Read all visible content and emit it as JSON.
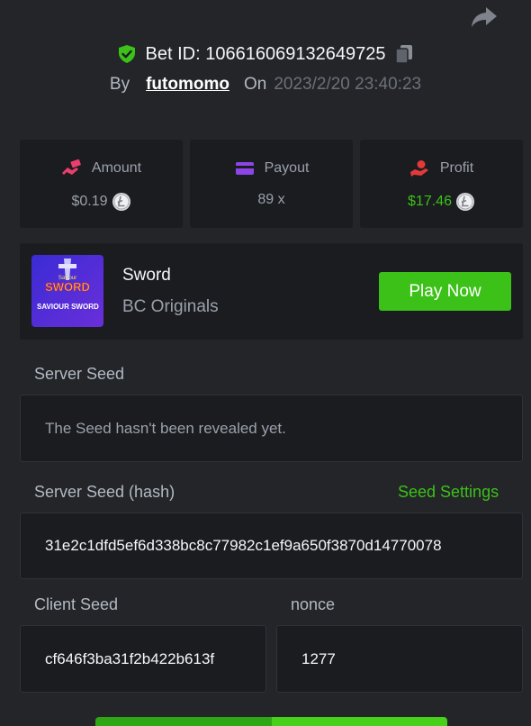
{
  "header": {
    "bet_label": "Bet ID: 106616069132649725",
    "by": "By",
    "user": "futomomo",
    "on": "On",
    "datetime": "2023/2/20 23:40:23"
  },
  "stats": {
    "amount": {
      "label": "Amount",
      "value": "$0.19",
      "icon": "money-hand-icon"
    },
    "payout": {
      "label": "Payout",
      "value": "89 x",
      "icon": "card-icon"
    },
    "profit": {
      "label": "Profit",
      "value": "$17.46",
      "icon": "profit-hand-icon"
    }
  },
  "game": {
    "name": "Sword",
    "provider": "BC Originals",
    "play_label": "Play Now",
    "thumb_text_top": "Saviour",
    "thumb_title": "SWORD",
    "thumb_text_bottom": "SAVIOUR SWORD"
  },
  "server_seed": {
    "label": "Server Seed",
    "value": "The Seed hasn't been revealed yet."
  },
  "server_seed_hash": {
    "label": "Server Seed (hash)",
    "settings_label": "Seed Settings",
    "value": "31e2c1dfd5ef6d338bc8c77982c1ef9a650f3870d14770078"
  },
  "client_seed": {
    "label": "Client Seed",
    "value": "cf646f3ba31f2b422b613f"
  },
  "nonce": {
    "label": "nonce",
    "value": "1277"
  },
  "colors": {
    "background": "#232529",
    "panel": "#1b1c20",
    "accent_green": "#3bc117",
    "amount_icon": "#ea3e6e",
    "payout_icon": "#8b45e8",
    "profit_icon": "#e23a3a"
  }
}
